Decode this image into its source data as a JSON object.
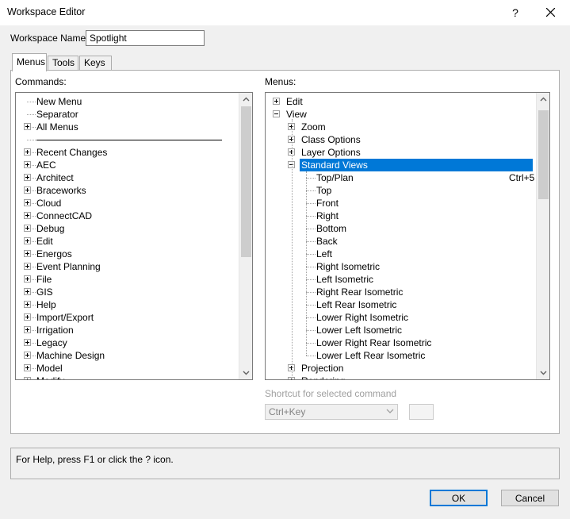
{
  "window": {
    "title": "Workspace Editor",
    "help_glyph": "?",
    "close_icon": "close-icon"
  },
  "workspace": {
    "label": "Workspace Name:",
    "value": "Spotlight"
  },
  "tabs": [
    {
      "label": "Menus",
      "active": true
    },
    {
      "label": "Tools",
      "active": false
    },
    {
      "label": "Keys",
      "active": false
    }
  ],
  "commands": {
    "label": "Commands:",
    "items": [
      {
        "text": "New Menu",
        "expander": false
      },
      {
        "text": "Separator",
        "expander": false
      },
      {
        "text": "All Menus",
        "expander": true
      },
      {
        "text": "separator-line",
        "separator": true
      },
      {
        "text": "Recent Changes",
        "expander": true
      },
      {
        "text": "AEC",
        "expander": true
      },
      {
        "text": "Architect",
        "expander": true
      },
      {
        "text": "Braceworks",
        "expander": true
      },
      {
        "text": "Cloud",
        "expander": true
      },
      {
        "text": "ConnectCAD",
        "expander": true
      },
      {
        "text": "Debug",
        "expander": true
      },
      {
        "text": "Edit",
        "expander": true
      },
      {
        "text": "Energos",
        "expander": true
      },
      {
        "text": "Event Planning",
        "expander": true
      },
      {
        "text": "File",
        "expander": true
      },
      {
        "text": "GIS",
        "expander": true
      },
      {
        "text": "Help",
        "expander": true
      },
      {
        "text": "Import/Export",
        "expander": true
      },
      {
        "text": "Irrigation",
        "expander": true
      },
      {
        "text": "Legacy",
        "expander": true
      },
      {
        "text": "Machine Design",
        "expander": true
      },
      {
        "text": "Model",
        "expander": true
      },
      {
        "text": "Modify",
        "expander": true
      }
    ]
  },
  "menus": {
    "label": "Menus:",
    "items": [
      {
        "text": "Edit",
        "level": 0,
        "expander": "plus"
      },
      {
        "text": "View",
        "level": 0,
        "expander": "minus"
      },
      {
        "text": "Zoom",
        "level": 1,
        "expander": "plus"
      },
      {
        "text": "Class Options",
        "level": 1,
        "expander": "plus"
      },
      {
        "text": "Layer Options",
        "level": 1,
        "expander": "plus"
      },
      {
        "text": "Standard Views",
        "level": 1,
        "expander": "minus",
        "selected": true
      },
      {
        "text": "Top/Plan",
        "level": 2,
        "shortcut": "Ctrl+5"
      },
      {
        "text": "Top",
        "level": 2
      },
      {
        "text": "Front",
        "level": 2
      },
      {
        "text": "Right",
        "level": 2
      },
      {
        "text": "Bottom",
        "level": 2
      },
      {
        "text": "Back",
        "level": 2
      },
      {
        "text": "Left",
        "level": 2
      },
      {
        "text": "Right Isometric",
        "level": 2
      },
      {
        "text": "Left Isometric",
        "level": 2
      },
      {
        "text": "Right Rear Isometric",
        "level": 2
      },
      {
        "text": "Left Rear Isometric",
        "level": 2
      },
      {
        "text": "Lower Right Isometric",
        "level": 2
      },
      {
        "text": "Lower Left Isometric",
        "level": 2
      },
      {
        "text": "Lower Right Rear Isometric",
        "level": 2
      },
      {
        "text": "Lower Left Rear Isometric",
        "level": 2
      },
      {
        "text": "Projection",
        "level": 1,
        "expander": "plus"
      },
      {
        "text": "Rendering",
        "level": 1,
        "expander": "plus"
      }
    ]
  },
  "shortcut": {
    "label": "Shortcut for selected command",
    "combo_value": "Ctrl+Key"
  },
  "help": {
    "text": "For Help, press F1 or click the ? icon."
  },
  "buttons": {
    "ok": "OK",
    "cancel": "Cancel"
  },
  "colors": {
    "selection": "#0078d7",
    "default_button_border": "#0078d7"
  }
}
